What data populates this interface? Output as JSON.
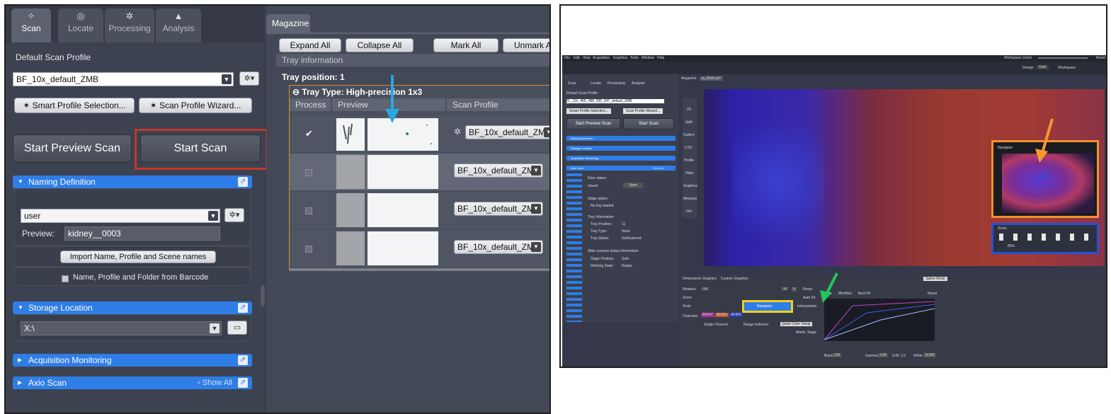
{
  "scan_panel": {
    "tabs": [
      {
        "label": "Scan",
        "icon": "scan-icon"
      },
      {
        "label": "Locate",
        "icon": "locate-icon"
      },
      {
        "label": "Processing",
        "icon": "processing-icon"
      },
      {
        "label": "Analysis",
        "icon": "analysis-icon"
      }
    ],
    "profile_label": "Default Scan Profile",
    "profile_value": "BF_10x_default_ZMB",
    "smart_profile_button": "Smart Profile Selection...",
    "wizard_button": "Scan Profile Wizard...",
    "start_preview_button": "Start Preview Scan",
    "start_scan_button": "Start Scan",
    "naming": {
      "title": "Naming Definition",
      "mode_value": "user",
      "preview_label": "Preview:",
      "preview_value": "kidney__0003",
      "import_button": "Import Name, Profile and Scene names",
      "barcode_label": "Name, Profile and Folder from Barcode"
    },
    "storage": {
      "title": "Storage Location",
      "path_value": "X:\\"
    },
    "acquisition_title": "Acquisition Monitoring",
    "axio": {
      "title": "Axio Scan",
      "show_all": "Show All"
    }
  },
  "magazine": {
    "tab_label": "Magazine",
    "buttons": [
      "Expand All",
      "Collapse All",
      "Mark All",
      "Unmark All"
    ],
    "tray_info_label": "Tray information",
    "tray_position_label": "Tray position:",
    "tray_position_value": "1",
    "tray_type": "Tray Type:  High-precision 1x3",
    "columns": [
      "Process",
      "Preview",
      "Scan Profile"
    ],
    "rows": [
      {
        "checked": true,
        "profile": "BF_10x_default_ZMB"
      },
      {
        "checked": false,
        "profile": "BF_10x_default_ZMB"
      },
      {
        "checked": false,
        "profile": "BF_10x_default_ZMB"
      },
      {
        "checked": false,
        "profile": "BF_10x_default_ZMB"
      }
    ]
  },
  "zen_app": {
    "menu": [
      "File",
      "Edit",
      "View",
      "Acquisition",
      "Graphics",
      "Tools",
      "Window",
      "Help"
    ],
    "workspace_zoom": "Workspace Zoom",
    "design_label": "Design",
    "design_value": "Dark",
    "workspace_label": "Workspace",
    "reset": "Reset",
    "tabs": [
      "Scan",
      "Locate",
      "Processing",
      "Analysis"
    ],
    "profile_label": "Default Scan Profile",
    "profile_value": "FL_10x_405_488_555_647_default_ZMB",
    "smart_profile_button": "Smart Profile Selection...",
    "wizard_button": "Scan Profile Wizard...",
    "start_preview_button": "Start Preview Scan",
    "start_scan_button": "Start Scan",
    "sections": [
      "Naming Definition",
      "Storage Location",
      "Acquisition Monitoring",
      "Axio Scan"
    ],
    "show_all": "Show All",
    "door_status_label": "Door status:",
    "door_status_value": "closed",
    "open_button": "Open",
    "stage_status_label": "Stage status:",
    "stage_status_value": "No tray loaded",
    "tray_info_label": "Tray Information:",
    "tray_position_label": "Tray Position:",
    "tray_position_value": "11",
    "tray_type_label": "Tray Type:",
    "tray_type_value": "None",
    "tray_status_label": "Tray Status:",
    "tray_status_value": "NotScanned",
    "scanner_status_label": "Slide scanner status information:",
    "stage_position_label": "Stage Position:",
    "stage_position_value": "Safe",
    "working_state_label": "Working State:",
    "working_state_value": "Ready",
    "doc_tab_magazine": "Magazine",
    "doc_tab_file": "ia_0020.czi*",
    "view_tabs": [
      "2D",
      "Split",
      "Gallery",
      "2.5D",
      "Profile",
      "Histo",
      "Graphics",
      "Measure",
      "Info"
    ],
    "navigator_title": "Navigator",
    "zoom_title": "Zoom",
    "zoom_value": "85%",
    "bottom_tabs": [
      "Dimensions",
      "Graphics",
      "Custom Graphics"
    ],
    "rotation_label": "Rotation",
    "rotation_min": "-180",
    "rotation_max": "180",
    "rotation_value": "0",
    "zoom_label": "Zoom",
    "auto_fit": "Auto Fit",
    "tools_label": "Tools",
    "navigator_button": "Navigator",
    "interpolation": "Interpolation",
    "channels_label": "Channels",
    "channels": [
      "AF647",
      "AF555",
      "AF405"
    ],
    "single_channel": "Single Channel",
    "range_indicator": "Range Indicator",
    "quick_color": "Quick Color Setup",
    "marks_stage": "Marks",
    "stage": "Stage",
    "spline_mode": "Spline Mode",
    "auto_label": "Auto",
    "minmax_label": "Min/Max",
    "best_fit": "Best Fit",
    "black_label": "Black",
    "black_value": "120",
    "gamma_label": "Gamma",
    "gamma_value": "1.00",
    "white_label": "White",
    "white_value": "11200",
    "set_value": "0.45",
    "one_value": "1.0"
  },
  "colors": {
    "highlight_red": "#c0392b",
    "arrow_blue": "#2aa6e0",
    "arrow_orange": "#f39a2e",
    "arrow_green": "#22c55e",
    "highlight_orange": "#f2912c",
    "highlight_blue": "#2451d6",
    "highlight_yellow": "#f0d020",
    "section_blue": "#2f7de6"
  }
}
